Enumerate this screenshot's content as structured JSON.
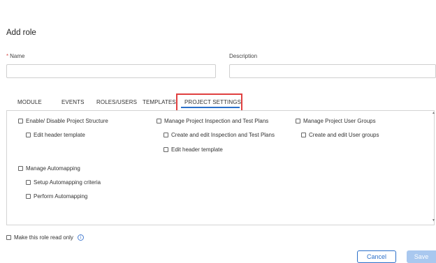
{
  "title": "Add role",
  "fields": {
    "name_required_mark": "*",
    "name_label": "Name",
    "description_label": "Description"
  },
  "tabs": [
    {
      "label": "MODULE"
    },
    {
      "label": "EVENTS"
    },
    {
      "label": "ROLES/USERS"
    },
    {
      "label": "TEMPLATES"
    },
    {
      "label": "PROJECT SETTINGS",
      "active": true
    }
  ],
  "permissions": {
    "enable_disable_structure": "Enable/ Disable Project Structure",
    "edit_header_template_1": "Edit header template",
    "manage_inspection_plans": "Manage Project Inspection and Test Plans",
    "create_edit_inspection": "Create and edit Inspection and Test Plans",
    "edit_header_template_2": "Edit header template",
    "manage_user_groups": "Manage Project User Groups",
    "create_edit_user_groups": "Create and edit User groups",
    "manage_automapping": "Manage Automapping",
    "setup_automapping": "Setup Automapping criteria",
    "perform_automapping": "Perform Automapping"
  },
  "read_only_label": "Make this role read only",
  "buttons": {
    "cancel": "Cancel",
    "save": "Save"
  },
  "colors": {
    "accent": "#2a6fc9",
    "highlight": "#e04040",
    "save_disabled": "#a9c8ef"
  }
}
